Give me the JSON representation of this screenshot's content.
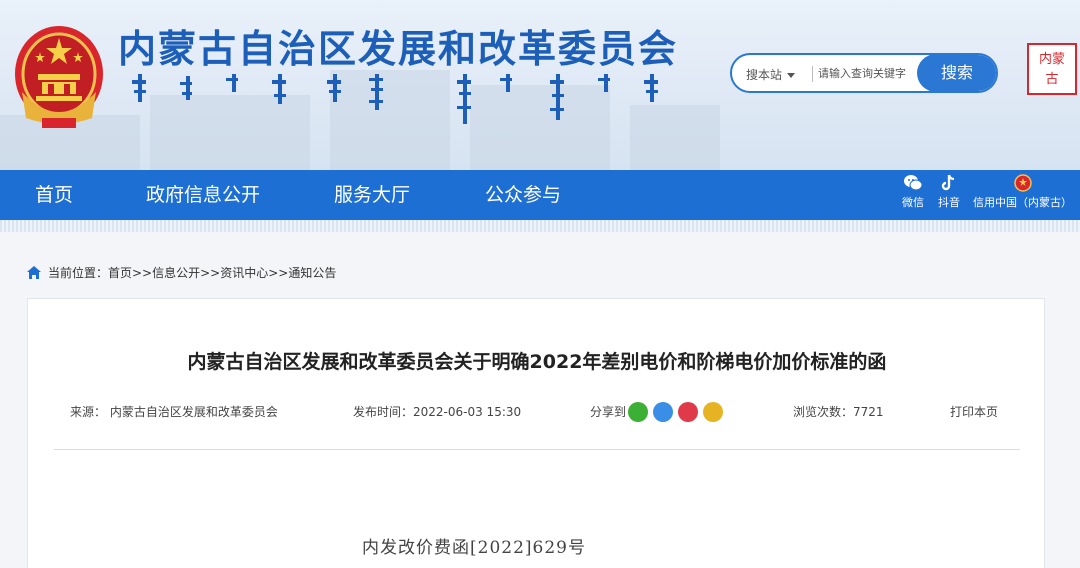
{
  "header": {
    "site_title": "内蒙古自治区发展和改革委员会",
    "search": {
      "scope_label": "搜本站",
      "placeholder": "请输入查询关键字",
      "button_label": "搜索"
    },
    "seal_text": "内蒙古"
  },
  "nav": {
    "items": [
      {
        "label": "首页"
      },
      {
        "label": "政府信息公开"
      },
      {
        "label": "服务大厅"
      },
      {
        "label": "公众参与"
      }
    ],
    "social": [
      {
        "label": "微信",
        "icon": "wechat-icon"
      },
      {
        "label": "抖音",
        "icon": "douyin-icon"
      },
      {
        "label": "信用中国（内蒙古）",
        "icon": "emblem-icon"
      }
    ]
  },
  "breadcrumb": {
    "text": "当前位置：首页>>信息公开>>资讯中心>>通知公告"
  },
  "article": {
    "title": "内蒙古自治区发展和改革委员会关于明确2022年差别电价和阶梯电价加价标准的函",
    "source": "来源： 内蒙古自治区发展和改革委员会",
    "published": "发布时间：2022-06-03 15:30",
    "share_label": "分享到",
    "views": "浏览次数：7721",
    "print_label": "打印本页",
    "doc_number": "内发改价费函[2022]629号"
  },
  "colors": {
    "brand_blue": "#1e6fd3",
    "title_blue": "#1d5fb8",
    "wechat_green": "#3cb034",
    "qq_blue": "#3a8ee6",
    "weibo_red": "#e0394a",
    "qzone_yellow": "#e6b422"
  }
}
